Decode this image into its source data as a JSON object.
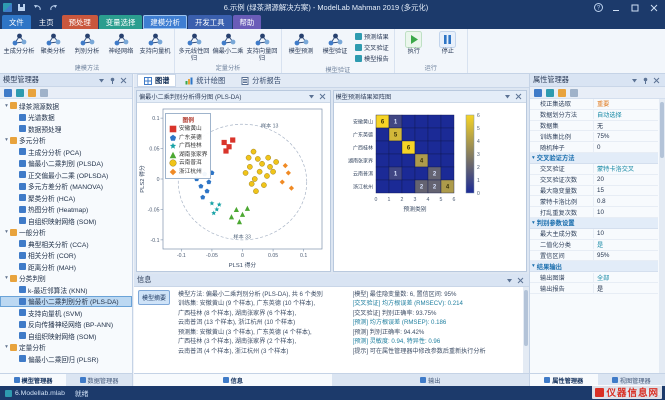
{
  "window": {
    "title": "6.示例 (绿茶溯源解决方案) - ModelLab Mahman 2019 (多元化)"
  },
  "ribbon": {
    "tabs": [
      {
        "label": "文件",
        "color": "#2e75c6"
      },
      {
        "label": "主页"
      },
      {
        "label": "预处理",
        "color": "#c9573d"
      },
      {
        "label": "变量选择",
        "color": "#2b9e8f"
      },
      {
        "label": "建模分析",
        "color": "#3e7ed2",
        "active": true
      },
      {
        "label": "开发工具",
        "color": "#3a5fae"
      },
      {
        "label": "帮助",
        "color": "#6a5cb8"
      }
    ],
    "groups": [
      {
        "label": "建模方法",
        "buttons": [
          {
            "label": "主成分分析"
          },
          {
            "label": "聚类分析"
          },
          {
            "label": "判别分析"
          },
          {
            "label": "神经网络"
          },
          {
            "label": "支持向量机"
          }
        ]
      },
      {
        "label": "定量分析",
        "buttons": [
          {
            "label": "多元线性回归"
          },
          {
            "label": "偏最小二乘"
          },
          {
            "label": "支持向量回归"
          }
        ]
      },
      {
        "label": "模型验证",
        "buttons": [
          {
            "label": "模型预测"
          },
          {
            "label": "模型验证"
          }
        ],
        "stack": [
          "预测结果",
          "交叉验证",
          "模型报告"
        ]
      },
      {
        "label": "运行",
        "buttons": [
          {
            "label": "执行",
            "icon": "play"
          },
          {
            "label": "停止",
            "icon": "pause"
          }
        ]
      }
    ]
  },
  "left_panel": {
    "title": "模型管理器",
    "tabs": [
      {
        "label": "模型管理器",
        "active": true
      },
      {
        "label": "数据管理器"
      }
    ]
  },
  "model_tree": {
    "items": [
      {
        "indent": 0,
        "folder": true,
        "label": "绿茶溯源数据"
      },
      {
        "indent": 1,
        "label": "光谱数据"
      },
      {
        "indent": 1,
        "label": "数据预处理"
      },
      {
        "indent": 0,
        "folder": true,
        "label": "多元分析"
      },
      {
        "indent": 1,
        "label": "主成分分析 (PCA)"
      },
      {
        "indent": 1,
        "label": "偏最小二乘判别 (PLSDA)"
      },
      {
        "indent": 1,
        "label": "正交偏最小二乘 (OPLSDA)"
      },
      {
        "indent": 1,
        "label": "多元方差分析 (MANOVA)"
      },
      {
        "indent": 1,
        "label": "聚类分析 (HCA)"
      },
      {
        "indent": 1,
        "label": "热图分析 (Heatmap)"
      },
      {
        "indent": 1,
        "label": "自组织映射网络 (SOM)"
      },
      {
        "indent": 0,
        "folder": true,
        "label": "一般分析"
      },
      {
        "indent": 1,
        "label": "典型相关分析 (CCA)"
      },
      {
        "indent": 1,
        "label": "相关分析 (COR)"
      },
      {
        "indent": 1,
        "label": "距离分析 (MAH)"
      },
      {
        "indent": 0,
        "folder": true,
        "label": "分类判别"
      },
      {
        "indent": 1,
        "label": "k-最近邻算法 (KNN)"
      },
      {
        "indent": 1,
        "label": "偏最小二乘判别分析 (PLS-DA)",
        "selected": true
      },
      {
        "indent": 1,
        "label": "支持向量机 (SVM)"
      },
      {
        "indent": 1,
        "label": "反向传播神经网络 (BP-ANN)"
      },
      {
        "indent": 1,
        "label": "自组织映射网络 (SOM)"
      },
      {
        "indent": 0,
        "folder": true,
        "label": "定量分析"
      },
      {
        "indent": 1,
        "label": "偏最小二乘回归 (PLSR)"
      }
    ]
  },
  "center": {
    "tabs": [
      {
        "label": "图谱",
        "icon": "grid",
        "active": true
      },
      {
        "label": "统计绘图",
        "icon": "bars"
      },
      {
        "label": "分析报告",
        "icon": "doc"
      }
    ]
  },
  "info": {
    "title": "信息",
    "side_label": "模型摘要",
    "tabs": [
      {
        "label": "信息",
        "active": true
      },
      {
        "label": "输出"
      }
    ],
    "left_lines": [
      {
        "t": "模型方法: 偏最小二乘判别分析 (PLS-DA), 共 6 个类别",
        "hl": false
      },
      {
        "t": "训练集: 安徽黄山 (9 个样本), 广东英德 (10 个样本),",
        "hl": false
      },
      {
        "t": "广西桂林 (8 个样本), 湖南张家界 (6 个样本),",
        "hl": false
      },
      {
        "t": "云南普洱 (13 个样本), 浙江杭州 (10 个样本)",
        "hl": false
      },
      {
        "t": "预测集: 安徽黄山 (3 个样本), 广东英德 (4 个样本),",
        "hl": false
      },
      {
        "t": "广西桂林 (3 个样本), 湖南张家界 (2 个样本),",
        "hl": false
      },
      {
        "t": "云南普洱 (4 个样本), 浙江杭州 (3 个样本)",
        "hl": false
      }
    ],
    "right_lines": [
      {
        "t": "[模型] 最佳隐变量数: 6, 置信区间: 95%",
        "hl": false
      },
      {
        "t": "[交叉验证] 均方根误差 (RMSECV): 0.214",
        "hl": true
      },
      {
        "t": "[交叉验证] 判别正确率: 93.75%",
        "hl": false
      },
      {
        "t": "[预测] 均方根误差 (RMSEP): 0.186",
        "hl": true
      },
      {
        "t": "[预测] 判别正确率: 94.42%",
        "hl": false
      },
      {
        "t": "[预测] 灵敏度: 0.94, 特异性: 0.96",
        "hl": true
      },
      {
        "t": "[提示] 可在属性管理器中修改参数后重新执行分析",
        "hl": false
      }
    ]
  },
  "properties": {
    "title": "属性管理器",
    "tabs": [
      {
        "label": "属性管理器",
        "active": true
      },
      {
        "label": "视图管理器"
      }
    ],
    "sections": [
      {
        "rows": [
          {
            "name": "校正集选取",
            "value": "重要",
            "vclass": "orange"
          },
          {
            "name": "数据划分方法",
            "value": "自动选择",
            "vclass": "teal"
          },
          {
            "name": "数据集",
            "value": "无"
          },
          {
            "name": "训练集比例",
            "value": "75%"
          },
          {
            "name": "随机种子",
            "value": "0"
          }
        ]
      },
      {
        "header": "交叉验证方法",
        "rows": [
          {
            "name": "交叉验证",
            "value": "蒙特卡洛交叉",
            "vclass": "teal"
          },
          {
            "name": "交叉验证次数",
            "value": "20"
          },
          {
            "name": "最大隐变量数",
            "value": "15"
          },
          {
            "name": "蒙特卡洛比例",
            "value": "0.8"
          },
          {
            "name": "打乱重复次数",
            "value": "10"
          }
        ]
      },
      {
        "header": "判别参数设置",
        "rows": [
          {
            "name": "最大主成分数",
            "value": "10"
          },
          {
            "name": "二值化分类",
            "value": "是",
            "vclass": "teal"
          },
          {
            "name": "置信区间",
            "value": "95%"
          }
        ]
      },
      {
        "header": "结果输出",
        "rows": [
          {
            "name": "输出图谱",
            "value": "全部",
            "vclass": "teal"
          },
          {
            "name": "输出报告",
            "value": "是"
          }
        ]
      }
    ]
  },
  "status": {
    "file": "6.Modellab.mlab",
    "ready": "就绪",
    "zoom": "100%"
  },
  "watermark": {
    "text": "仪器信息网"
  },
  "chart_data": [
    {
      "type": "scatter",
      "window_title": "偏最小二乘判别分析得分图 (PLS-DA)",
      "xlabel": "PLS1 得分",
      "ylabel": "PLS2 得分",
      "xlim": [
        -0.13,
        0.13
      ],
      "ylim": [
        -0.115,
        0.115
      ],
      "xticks": [
        -0.1,
        -0.05,
        0,
        0.05,
        0.1
      ],
      "yticks": [
        -0.1,
        -0.05,
        0,
        0.05,
        0.1
      ],
      "legend_title": "图例",
      "legend_position": "upper-left",
      "grid": false,
      "confidence_ellipse": {
        "cx": 0.0,
        "cy": -0.005,
        "rx": 0.105,
        "ry": 0.095
      },
      "annotations": [
        {
          "text": "样本 13",
          "x": 0.03,
          "y": 0.085
        },
        {
          "text": "样本 33",
          "x": -0.015,
          "y": -0.098
        }
      ],
      "series": [
        {
          "name": "安徽黄山",
          "marker": "square",
          "color": "#d9342b",
          "points": [
            [
              -0.03,
              0.06
            ],
            [
              -0.022,
              0.053
            ],
            [
              -0.027,
              0.046
            ],
            [
              -0.016,
              0.064
            ]
          ]
        },
        {
          "name": "广东英德",
          "marker": "pentagon",
          "color": "#2e75c6",
          "points": [
            [
              -0.075,
              0.0
            ],
            [
              -0.068,
              -0.012
            ],
            [
              -0.062,
              0.008
            ],
            [
              -0.058,
              -0.02
            ],
            [
              -0.07,
              0.015
            ],
            [
              -0.055,
              -0.005
            ],
            [
              -0.065,
              -0.03
            ],
            [
              -0.05,
              0.01
            ]
          ]
        },
        {
          "name": "广西桂林",
          "marker": "star",
          "color": "#17a2a6",
          "points": [
            [
              -0.05,
              -0.04
            ],
            [
              -0.042,
              -0.05
            ],
            [
              -0.038,
              -0.042
            ],
            [
              -0.047,
              -0.056
            ]
          ]
        },
        {
          "name": "湖南张家界",
          "marker": "triangle",
          "color": "#4ca832",
          "points": [
            [
              -0.01,
              -0.05
            ],
            [
              0.0,
              -0.058
            ],
            [
              -0.018,
              -0.062
            ],
            [
              0.008,
              -0.048
            ],
            [
              -0.005,
              -0.07
            ]
          ]
        },
        {
          "name": "云南普洱",
          "marker": "circle",
          "color": "#f0c419",
          "points": [
            [
              0.005,
              0.01
            ],
            [
              0.012,
              0.02
            ],
            [
              0.02,
              0.0
            ],
            [
              0.028,
              0.012
            ],
            [
              0.015,
              -0.008
            ],
            [
              0.032,
              0.025
            ],
            [
              0.04,
              0.005
            ],
            [
              0.025,
              0.033
            ],
            [
              0.01,
              0.035
            ],
            [
              0.045,
              0.02
            ],
            [
              0.035,
              -0.01
            ],
            [
              0.05,
              0.012
            ],
            [
              0.022,
              -0.02
            ],
            [
              0.042,
              0.035
            ],
            [
              0.055,
              0.028
            ],
            [
              0.018,
              0.045
            ]
          ]
        },
        {
          "name": "浙江杭州",
          "marker": "diamond",
          "color": "#f08a24",
          "points": [
            [
              0.065,
              -0.005
            ],
            [
              0.075,
              0.01
            ],
            [
              0.08,
              -0.015
            ],
            [
              0.07,
              0.022
            ]
          ]
        }
      ]
    },
    {
      "type": "heatmap",
      "window_title": "模型预测结果矩阵图",
      "xlabel": "预测类别",
      "rows": [
        "安徽黄山",
        "广东英德",
        "广西桂林",
        "湖南张家界",
        "云南普洱",
        "浙江杭州"
      ],
      "xticks": [
        0,
        1,
        2,
        3,
        4,
        5,
        6
      ],
      "matrix": [
        [
          6,
          1,
          0,
          0,
          0,
          0
        ],
        [
          0,
          5,
          0,
          0,
          0,
          0
        ],
        [
          0,
          0,
          6,
          0,
          0,
          0
        ],
        [
          0,
          0,
          0,
          4,
          0,
          0
        ],
        [
          0,
          1,
          0,
          0,
          2,
          0
        ],
        [
          0,
          0,
          0,
          2,
          2,
          4
        ]
      ],
      "vmin": 0,
      "vmax": 6,
      "colorbar_ticks": [
        0,
        1,
        2,
        3,
        4,
        5,
        6
      ],
      "colormap": [
        "#1b2a96",
        "#f6d426"
      ]
    }
  ]
}
